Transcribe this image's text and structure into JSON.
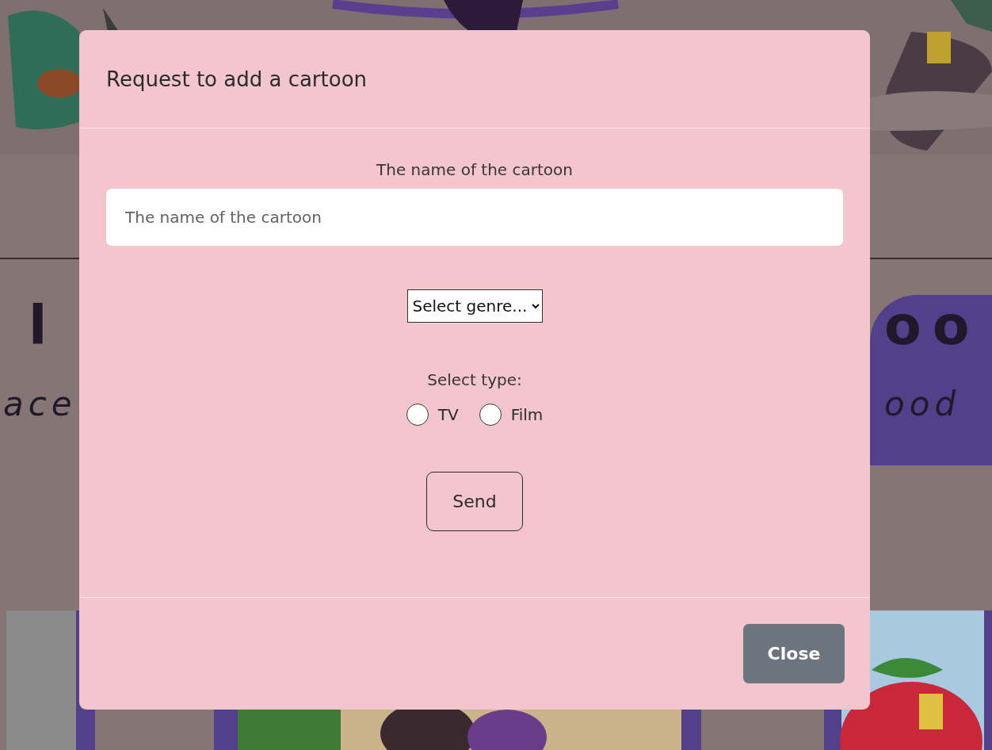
{
  "background": {
    "heading_left": "l",
    "heading_right": "oo",
    "subheading_left": "ace",
    "subheading_right": "ood"
  },
  "modal": {
    "title": "Request to add a cartoon",
    "name_field": {
      "label": "The name of the cartoon",
      "placeholder": "The name of the cartoon"
    },
    "genre_select": {
      "value": "Select genre..."
    },
    "type": {
      "label": "Select type:",
      "options": [
        {
          "label": "TV",
          "selected": false
        },
        {
          "label": "Film",
          "selected": false
        }
      ]
    },
    "send_button": "Send",
    "close_button": "Close"
  }
}
